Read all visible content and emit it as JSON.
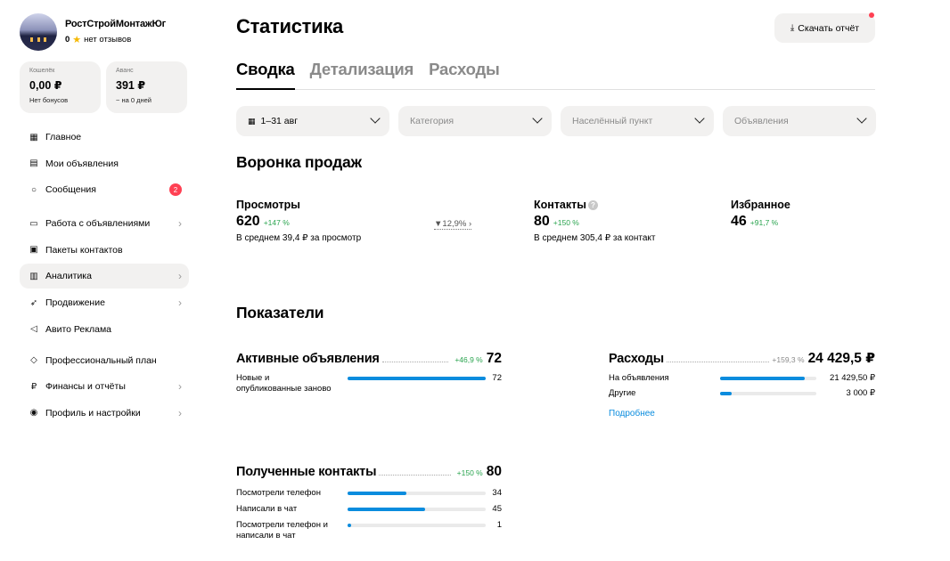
{
  "profile": {
    "name": "РостСтройМонтажЮг",
    "rating": "0",
    "reviews": "нет отзывов"
  },
  "wallets": [
    {
      "label": "Кошелёк",
      "value": "0,00 ₽",
      "sub": "Нет бонусов"
    },
    {
      "label": "Аванс",
      "value": "391 ₽",
      "sub": "~ на 0 дней"
    }
  ],
  "menu": [
    {
      "label": "Главное",
      "icon": "grid-icon"
    },
    {
      "label": "Мои объявления",
      "icon": "doc-icon"
    },
    {
      "label": "Сообщения",
      "icon": "chat-icon",
      "badge": "2"
    },
    {
      "label": "Работа с объявлениями",
      "icon": "briefcase-icon"
    },
    {
      "label": "Пакеты контактов",
      "icon": "card-icon"
    },
    {
      "label": "Аналитика",
      "icon": "chart-icon"
    },
    {
      "label": "Продвижение",
      "icon": "rocket-icon"
    },
    {
      "label": "Авито Реклама",
      "icon": "megaphone-icon"
    },
    {
      "label": "Профессиональный план",
      "icon": "diamond-icon"
    },
    {
      "label": "Финансы и отчёты",
      "icon": "ruble-icon"
    },
    {
      "label": "Профиль и настройки",
      "icon": "user-icon"
    }
  ],
  "header": {
    "title": "Статистика",
    "download": "Скачать отчёт"
  },
  "tabs": [
    "Сводка",
    "Детализация",
    "Расходы"
  ],
  "filters": {
    "period": "1–31 авг",
    "category": "Категория",
    "location": "Населённый пункт",
    "ads": "Объявления"
  },
  "funnel": {
    "title": "Воронка продаж",
    "views": {
      "label": "Просмотры",
      "value": "620",
      "change": "+147 %",
      "avg": "В среднем 39,4 ₽ за просмотр"
    },
    "conversion": "12,9%",
    "contacts": {
      "label": "Контакты",
      "value": "80",
      "change": "+150 %",
      "avg": "В среднем 305,4 ₽ за контакт"
    },
    "favorites": {
      "label": "Избранное",
      "value": "46",
      "change": "+91,7 %"
    }
  },
  "indicators": {
    "title": "Показатели",
    "active": {
      "title": "Активные объявления",
      "change": "+46,9 %",
      "total": "72",
      "rows": [
        {
          "label": "Новые и опубликованные заново",
          "value": "72",
          "fraction": 1.0
        }
      ]
    },
    "expenses": {
      "title": "Расходы",
      "change": "+159,3 %",
      "total": "24 429,5 ₽",
      "rows": [
        {
          "label": "На объявления",
          "value": "21 429,50 ₽",
          "fraction": 0.88
        },
        {
          "label": "Другие",
          "value": "3 000 ₽",
          "fraction": 0.12
        }
      ],
      "more": "Подробнее"
    },
    "contacts": {
      "title": "Полученные контакты",
      "change": "+150 %",
      "total": "80",
      "rows": [
        {
          "label": "Посмотрели телефон",
          "value": "34",
          "fraction": 0.425
        },
        {
          "label": "Написали в чат",
          "value": "45",
          "fraction": 0.5625
        },
        {
          "label": "Посмотрели телефон и написали в чат",
          "value": "1",
          "fraction": 0.0125
        }
      ]
    }
  },
  "colors": {
    "accent": "#0a8cde",
    "positive": "#2aa44f",
    "badge": "#ff4053"
  }
}
